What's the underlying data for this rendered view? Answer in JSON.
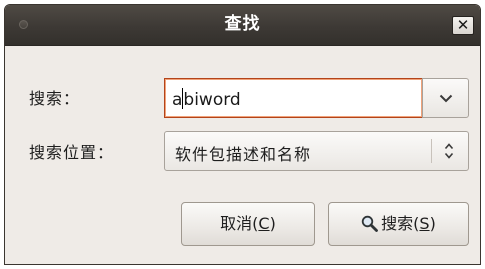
{
  "dialog": {
    "title": "查找",
    "close_glyph": "✕"
  },
  "search": {
    "label": "搜索：",
    "value_before_caret": "a",
    "value_after_caret": "biword",
    "dropdown_icon": "chevron-down-icon"
  },
  "scope": {
    "label": "搜索位置：",
    "selected": "软件包描述和名称",
    "spinner_icon": "up-down-arrows-icon"
  },
  "buttons": {
    "cancel": {
      "prefix": "取消(",
      "mnemonic": "C",
      "suffix": ")"
    },
    "search": {
      "prefix": "搜索(",
      "mnemonic": "S",
      "suffix": ")",
      "icon": "magnifier-icon"
    }
  }
}
